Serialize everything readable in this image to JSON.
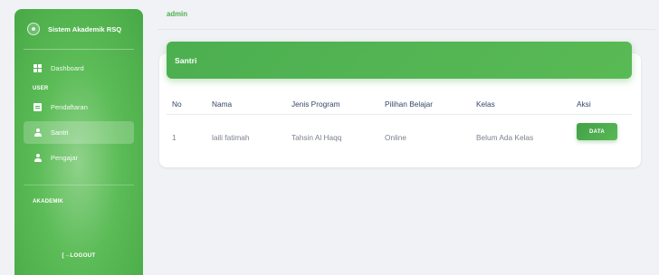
{
  "sidebar": {
    "brand": "Sistem Akademik RSQ",
    "items": [
      {
        "label": "Dashboard",
        "icon": "dashboard-icon"
      },
      {
        "label": "Pendaftaran",
        "icon": "document-icon"
      },
      {
        "label": "Santri",
        "icon": "user-icon",
        "active": true
      },
      {
        "label": "Pengajar",
        "icon": "user-icon"
      }
    ],
    "section_user": "USER",
    "section_akademik": "AKADEMIK",
    "logout": "[→LOGOUT"
  },
  "topbar": {
    "username": "admin"
  },
  "card": {
    "title": "Santri",
    "columns": [
      "No",
      "Nama",
      "Jenis Program",
      "Pilihan Belajar",
      "Kelas",
      "Aksi"
    ],
    "rows": [
      {
        "no": "1",
        "nama": "laili fatimah",
        "jenis_program": "Tahsin Al Haqq",
        "pilihan_belajar": "Online",
        "kelas": "Belum Ada Kelas",
        "aksi": "DATA"
      }
    ]
  },
  "colors": {
    "accent": "#4caf50",
    "header_text": "#344767",
    "cell_text": "#7b8190"
  }
}
